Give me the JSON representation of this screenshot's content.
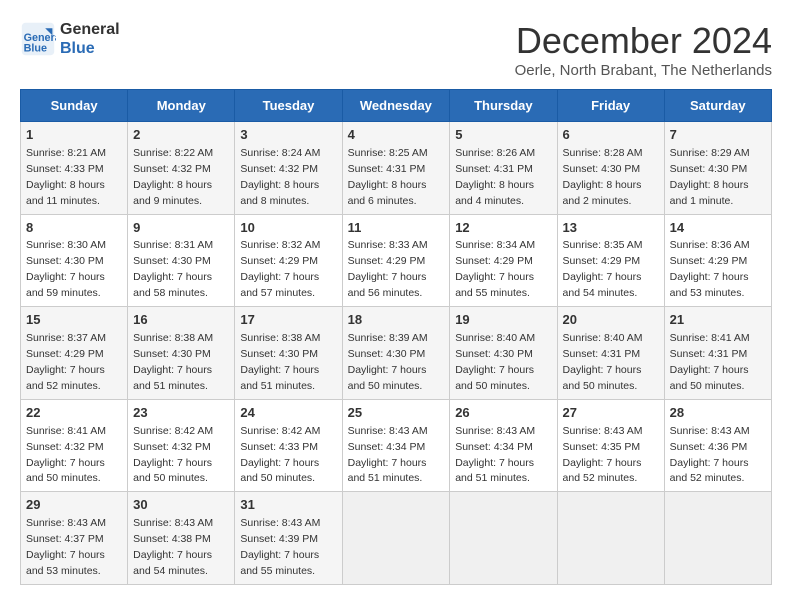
{
  "logo": {
    "line1": "General",
    "line2": "Blue"
  },
  "title": "December 2024",
  "location": "Oerle, North Brabant, The Netherlands",
  "days_of_week": [
    "Sunday",
    "Monday",
    "Tuesday",
    "Wednesday",
    "Thursday",
    "Friday",
    "Saturday"
  ],
  "weeks": [
    [
      {
        "num": "1",
        "sunrise": "8:21 AM",
        "sunset": "4:33 PM",
        "daylight": "8 hours and 11 minutes."
      },
      {
        "num": "2",
        "sunrise": "8:22 AM",
        "sunset": "4:32 PM",
        "daylight": "8 hours and 9 minutes."
      },
      {
        "num": "3",
        "sunrise": "8:24 AM",
        "sunset": "4:32 PM",
        "daylight": "8 hours and 8 minutes."
      },
      {
        "num": "4",
        "sunrise": "8:25 AM",
        "sunset": "4:31 PM",
        "daylight": "8 hours and 6 minutes."
      },
      {
        "num": "5",
        "sunrise": "8:26 AM",
        "sunset": "4:31 PM",
        "daylight": "8 hours and 4 minutes."
      },
      {
        "num": "6",
        "sunrise": "8:28 AM",
        "sunset": "4:30 PM",
        "daylight": "8 hours and 2 minutes."
      },
      {
        "num": "7",
        "sunrise": "8:29 AM",
        "sunset": "4:30 PM",
        "daylight": "8 hours and 1 minute."
      }
    ],
    [
      {
        "num": "8",
        "sunrise": "8:30 AM",
        "sunset": "4:30 PM",
        "daylight": "7 hours and 59 minutes."
      },
      {
        "num": "9",
        "sunrise": "8:31 AM",
        "sunset": "4:30 PM",
        "daylight": "7 hours and 58 minutes."
      },
      {
        "num": "10",
        "sunrise": "8:32 AM",
        "sunset": "4:29 PM",
        "daylight": "7 hours and 57 minutes."
      },
      {
        "num": "11",
        "sunrise": "8:33 AM",
        "sunset": "4:29 PM",
        "daylight": "7 hours and 56 minutes."
      },
      {
        "num": "12",
        "sunrise": "8:34 AM",
        "sunset": "4:29 PM",
        "daylight": "7 hours and 55 minutes."
      },
      {
        "num": "13",
        "sunrise": "8:35 AM",
        "sunset": "4:29 PM",
        "daylight": "7 hours and 54 minutes."
      },
      {
        "num": "14",
        "sunrise": "8:36 AM",
        "sunset": "4:29 PM",
        "daylight": "7 hours and 53 minutes."
      }
    ],
    [
      {
        "num": "15",
        "sunrise": "8:37 AM",
        "sunset": "4:29 PM",
        "daylight": "7 hours and 52 minutes."
      },
      {
        "num": "16",
        "sunrise": "8:38 AM",
        "sunset": "4:30 PM",
        "daylight": "7 hours and 51 minutes."
      },
      {
        "num": "17",
        "sunrise": "8:38 AM",
        "sunset": "4:30 PM",
        "daylight": "7 hours and 51 minutes."
      },
      {
        "num": "18",
        "sunrise": "8:39 AM",
        "sunset": "4:30 PM",
        "daylight": "7 hours and 50 minutes."
      },
      {
        "num": "19",
        "sunrise": "8:40 AM",
        "sunset": "4:30 PM",
        "daylight": "7 hours and 50 minutes."
      },
      {
        "num": "20",
        "sunrise": "8:40 AM",
        "sunset": "4:31 PM",
        "daylight": "7 hours and 50 minutes."
      },
      {
        "num": "21",
        "sunrise": "8:41 AM",
        "sunset": "4:31 PM",
        "daylight": "7 hours and 50 minutes."
      }
    ],
    [
      {
        "num": "22",
        "sunrise": "8:41 AM",
        "sunset": "4:32 PM",
        "daylight": "7 hours and 50 minutes."
      },
      {
        "num": "23",
        "sunrise": "8:42 AM",
        "sunset": "4:32 PM",
        "daylight": "7 hours and 50 minutes."
      },
      {
        "num": "24",
        "sunrise": "8:42 AM",
        "sunset": "4:33 PM",
        "daylight": "7 hours and 50 minutes."
      },
      {
        "num": "25",
        "sunrise": "8:43 AM",
        "sunset": "4:34 PM",
        "daylight": "7 hours and 51 minutes."
      },
      {
        "num": "26",
        "sunrise": "8:43 AM",
        "sunset": "4:34 PM",
        "daylight": "7 hours and 51 minutes."
      },
      {
        "num": "27",
        "sunrise": "8:43 AM",
        "sunset": "4:35 PM",
        "daylight": "7 hours and 52 minutes."
      },
      {
        "num": "28",
        "sunrise": "8:43 AM",
        "sunset": "4:36 PM",
        "daylight": "7 hours and 52 minutes."
      }
    ],
    [
      {
        "num": "29",
        "sunrise": "8:43 AM",
        "sunset": "4:37 PM",
        "daylight": "7 hours and 53 minutes."
      },
      {
        "num": "30",
        "sunrise": "8:43 AM",
        "sunset": "4:38 PM",
        "daylight": "7 hours and 54 minutes."
      },
      {
        "num": "31",
        "sunrise": "8:43 AM",
        "sunset": "4:39 PM",
        "daylight": "7 hours and 55 minutes."
      },
      null,
      null,
      null,
      null
    ]
  ],
  "labels": {
    "sunrise": "Sunrise:",
    "sunset": "Sunset:",
    "daylight": "Daylight:"
  }
}
